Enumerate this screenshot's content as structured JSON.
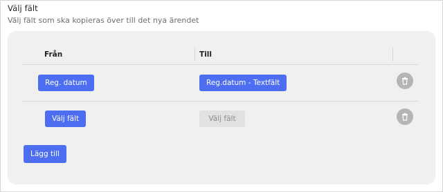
{
  "section": {
    "title": "Välj fält",
    "subtitle": "Välj fält som ska kopieras över till det nya ärendet"
  },
  "table": {
    "headers": {
      "from": "Från",
      "to": "Till"
    },
    "rows": [
      {
        "from_label": "Reg. datum",
        "to_label": "Reg.datum - Textfält",
        "to_disabled": false
      },
      {
        "from_label": "Välj fält",
        "to_label": "Välj fält",
        "to_disabled": true
      }
    ]
  },
  "actions": {
    "add_label": "Lägg till"
  },
  "icons": {
    "delete": "trash-icon"
  },
  "colors": {
    "primary": "#4d6ef0",
    "disabled_bg": "#e1e1e1",
    "panel_bg": "#f0f0f0",
    "trash_bg": "#b5b5b5"
  }
}
